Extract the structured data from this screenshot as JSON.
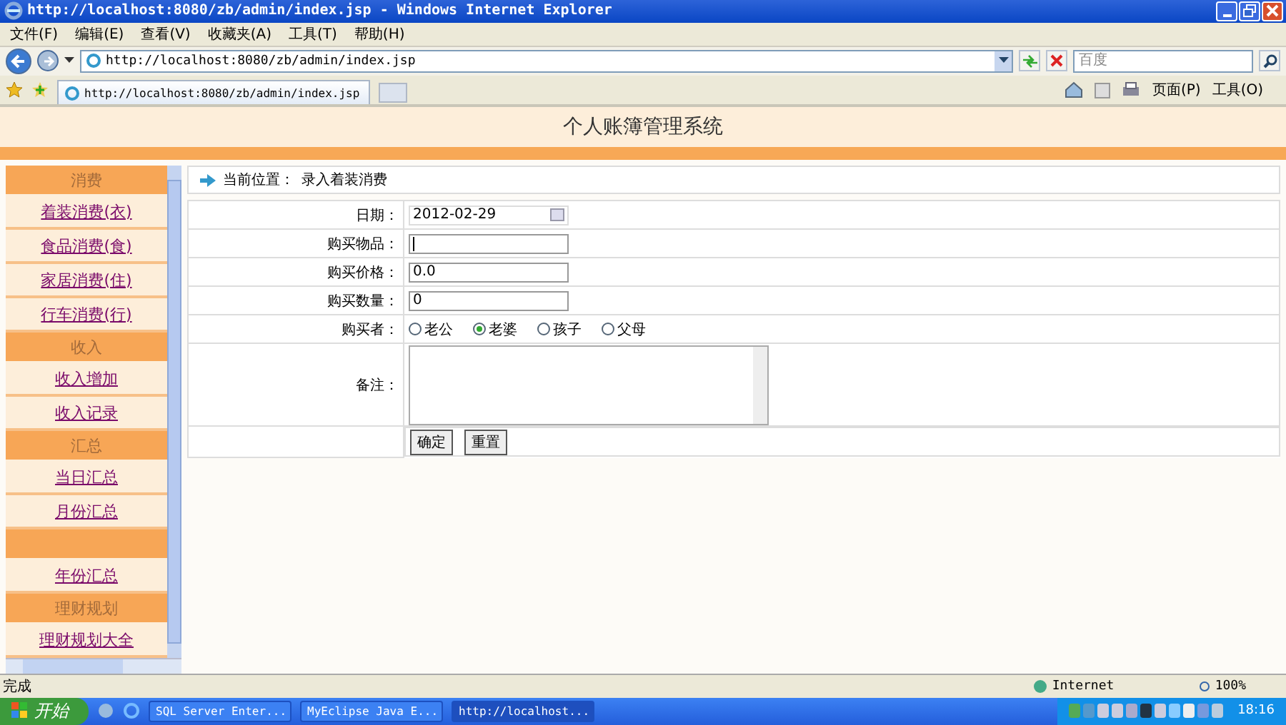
{
  "window": {
    "title": "http://localhost:8080/zb/admin/index.jsp - Windows Internet Explorer"
  },
  "menu": [
    "文件(F)",
    "编辑(E)",
    "查看(V)",
    "收藏夹(A)",
    "工具(T)",
    "帮助(H)"
  ],
  "address": {
    "value": "http://localhost:8080/zb/admin/index.jsp"
  },
  "search": {
    "placeholder": "百度"
  },
  "tab": {
    "label": "http://localhost:8080/zb/admin/index.jsp"
  },
  "commands": [
    "页面(P)",
    "工具(O)"
  ],
  "page": {
    "title": "个人账簿管理系统",
    "sidebar": [
      {
        "kind": "header",
        "label": "消费"
      },
      {
        "kind": "link",
        "label": "着装消费(衣)"
      },
      {
        "kind": "link",
        "label": "食品消费(食)"
      },
      {
        "kind": "link",
        "label": "家居消费(住)"
      },
      {
        "kind": "link",
        "label": "行车消费(行)"
      },
      {
        "kind": "header",
        "label": "收入"
      },
      {
        "kind": "link",
        "label": "收入增加"
      },
      {
        "kind": "link",
        "label": "收入记录"
      },
      {
        "kind": "header",
        "label": "汇总"
      },
      {
        "kind": "link",
        "label": "当日汇总"
      },
      {
        "kind": "link",
        "label": "月份汇总"
      },
      {
        "kind": "blank"
      },
      {
        "kind": "link",
        "label": "年份汇总"
      },
      {
        "kind": "header",
        "label": "理财规划"
      },
      {
        "kind": "link",
        "label": "理财规划大全"
      }
    ],
    "breadcrumb": {
      "label": "当前位置：",
      "value": "录入着装消费"
    },
    "form": [
      {
        "kind": "date",
        "label": "日期：",
        "value": "2012-02-29"
      },
      {
        "kind": "text",
        "label": "购买物品：",
        "focused": true
      },
      {
        "kind": "text",
        "label": "购买价格：",
        "value": "0.0"
      },
      {
        "kind": "text",
        "label": "购买数量：",
        "value": "0"
      },
      {
        "kind": "radio",
        "label": "购买者：",
        "options": [
          {
            "label": "老公",
            "selected": false
          },
          {
            "label": "老婆",
            "selected": true
          },
          {
            "label": "孩子",
            "selected": false
          },
          {
            "label": "父母",
            "selected": false
          }
        ]
      },
      {
        "kind": "textarea",
        "label": "备注："
      }
    ],
    "buttons": [
      "确定",
      "重置"
    ]
  },
  "status_bar": {
    "text": "完成",
    "zone": "Internet",
    "zoom": "100%"
  },
  "taskbar": {
    "start": "开始",
    "tasks": [
      "SQL Server Enter...",
      "MyEclipse Java E...",
      "http://localhost..."
    ],
    "clock": "18:16"
  }
}
